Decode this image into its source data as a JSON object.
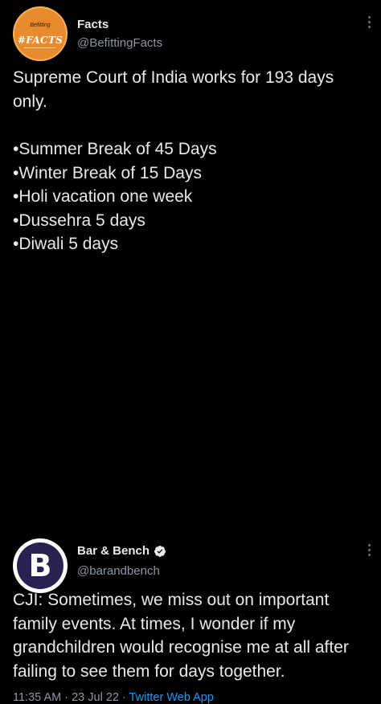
{
  "tweets": [
    {
      "avatar_small_text": "Befitting",
      "avatar_text": "#FACTS",
      "name": "Facts",
      "handle": "@BefittingFacts",
      "text_intro": "Supreme Court of India works for 193 days only.",
      "bullets": [
        "•Summer Break of 45 Days",
        "•Winter Break of 15 Days",
        "•Holi vacation one week",
        "•Dussehra 5 days",
        "•Diwali 5 days"
      ],
      "avatar_color": "#e88b2c"
    },
    {
      "avatar_letter": "B",
      "name": "Bar & Bench",
      "verified": true,
      "handle": "@barandbench",
      "text": "CJI: Sometimes, we miss out on important family events. At times, I wonder if my grandchildren would recognise me at all after failing to see them for days together.",
      "time": "11:35 AM",
      "separator": "·",
      "date": "23 Jul 22",
      "app": "Twitter Web App",
      "avatar_color": "#2b2150"
    }
  ],
  "colors": {
    "background": "#000000",
    "text": "#e7e9ea",
    "secondary": "#8b98a5",
    "link": "#1d9bf0",
    "verified": "#1d9bf0"
  },
  "icons": {
    "more": "more-options-icon",
    "verified": "verified-badge-icon"
  }
}
